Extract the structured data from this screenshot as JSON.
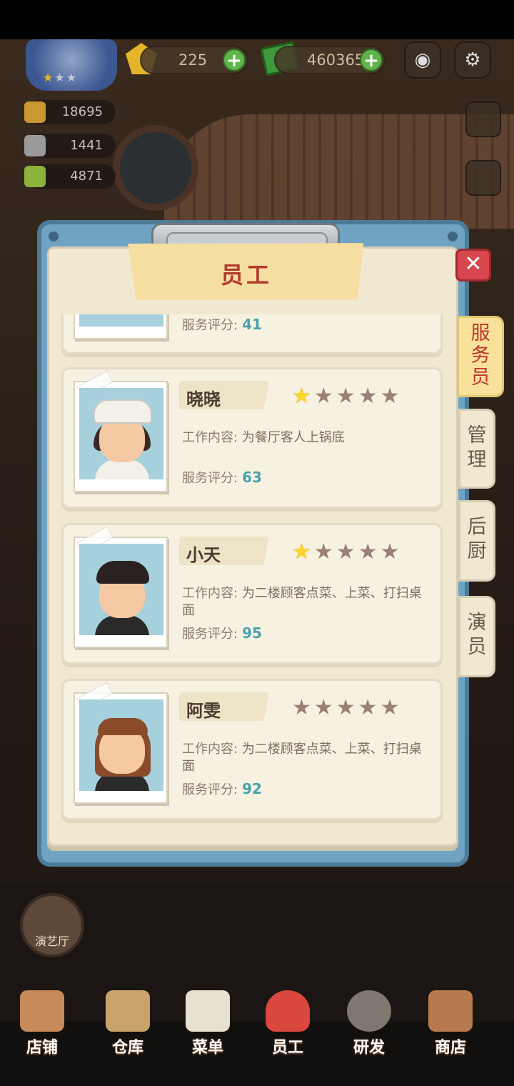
{
  "hud": {
    "rank_stars": 1,
    "gems": "225",
    "cash": "460365",
    "stats": [
      "18695",
      "1441",
      "4871"
    ]
  },
  "modal": {
    "title": "员工",
    "close_label": "✕",
    "tabs": [
      {
        "label": "服务员",
        "active": true
      },
      {
        "label": "管理",
        "active": false
      },
      {
        "label": "后厨",
        "active": false
      },
      {
        "label": "演员",
        "active": false
      }
    ],
    "partial_card": {
      "score_label": "服务评分:",
      "score": "41"
    },
    "employees": [
      {
        "name": "晓晓",
        "stars": 1,
        "job_label": "工作内容:",
        "job": "为餐厅客人上锅底",
        "score_label": "服务评分:",
        "score": "63"
      },
      {
        "name": "小天",
        "stars": 1,
        "job_label": "工作内容:",
        "job": "为二楼顾客点菜、上菜、打扫桌面",
        "score_label": "服务评分:",
        "score": "95"
      },
      {
        "name": "阿雯",
        "stars": 0,
        "job_label": "工作内容:",
        "job": "为二楼顾客点菜、上菜、打扫桌面",
        "score_label": "服务评分:",
        "score": "92"
      }
    ]
  },
  "side_button": "演艺厅",
  "nav": [
    {
      "label": "店铺",
      "icon": "shop-building-icon"
    },
    {
      "label": "仓库",
      "icon": "warehouse-boxes-icon"
    },
    {
      "label": "菜单",
      "icon": "menu-clipboard-icon"
    },
    {
      "label": "员工",
      "icon": "staff-person-icon"
    },
    {
      "label": "研发",
      "icon": "research-pot-icon"
    },
    {
      "label": "商店",
      "icon": "store-stall-icon"
    }
  ],
  "colors": {
    "modal_frame": "#6fa3c1",
    "paper": "#f1e8d2",
    "title_red": "#b33a2c",
    "score_teal": "#47a3ac",
    "star_gold": "#ffd42e",
    "star_empty": "#9a8173",
    "close_red": "#d8474d"
  }
}
